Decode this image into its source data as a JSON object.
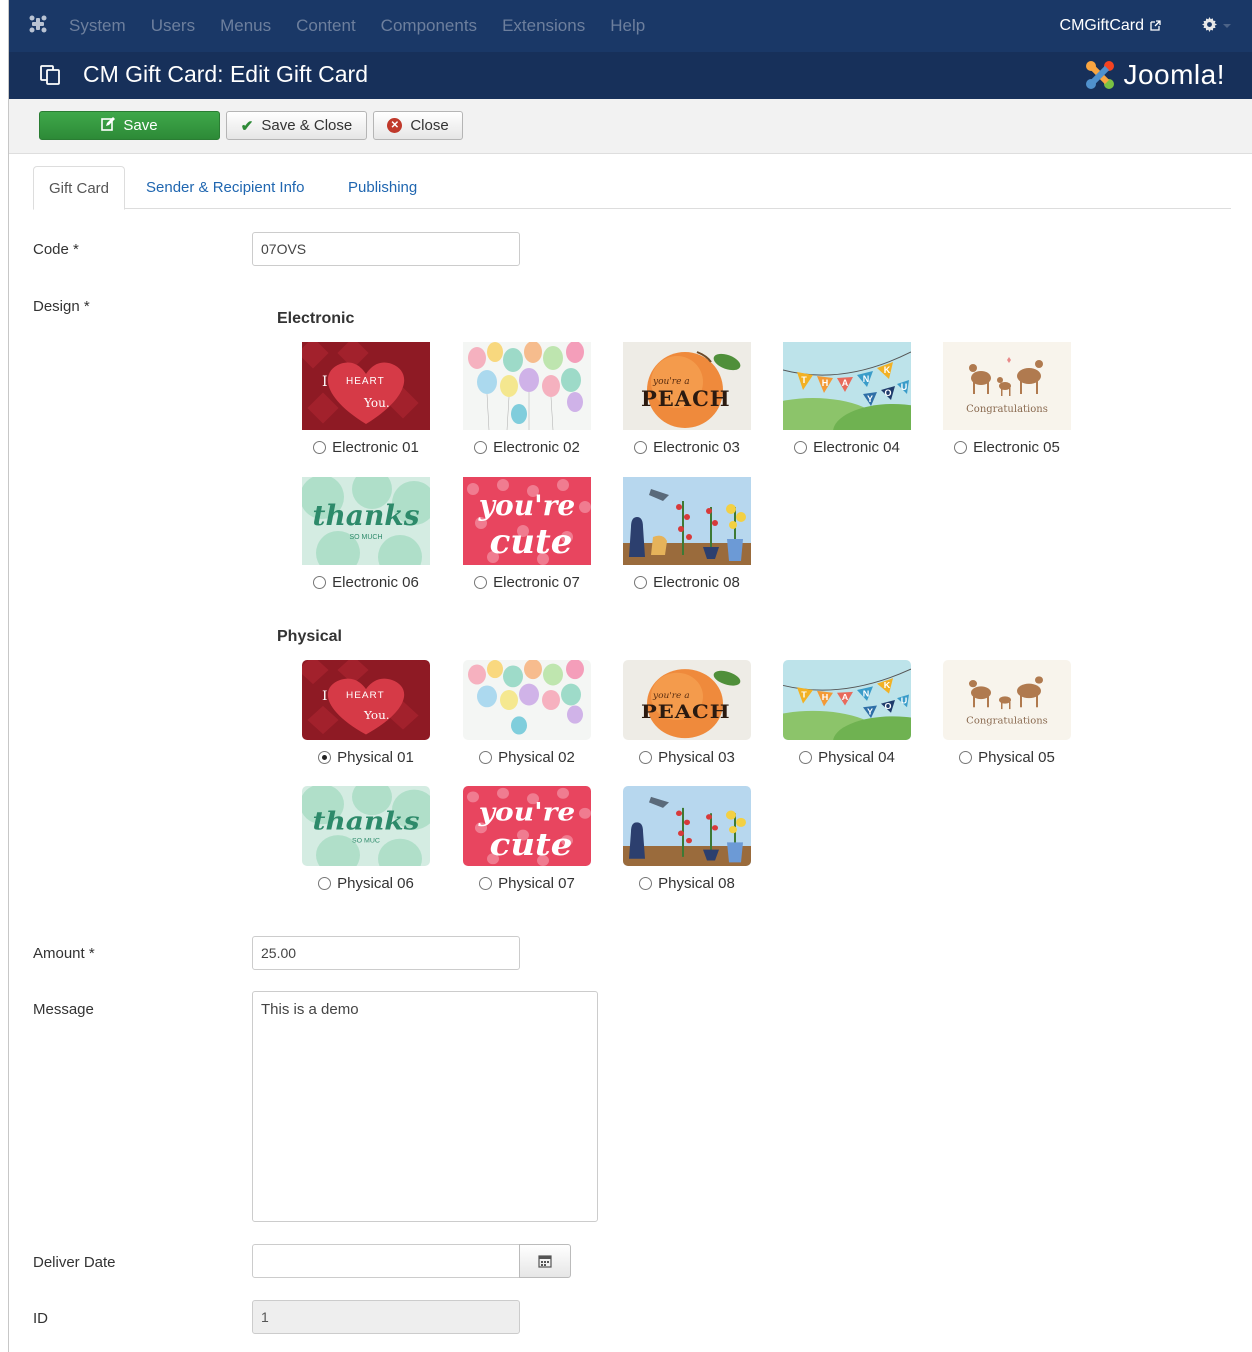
{
  "topnav": {
    "menu": [
      "System",
      "Users",
      "Menus",
      "Content",
      "Components",
      "Extensions",
      "Help"
    ],
    "site_name": "CMGiftCard"
  },
  "titlebar": {
    "title": "CM Gift Card: Edit Gift Card",
    "brand": "Joomla!"
  },
  "toolbar": {
    "save": "Save",
    "save_close": "Save & Close",
    "close": "Close"
  },
  "tabs": [
    "Gift Card",
    "Sender & Recipient Info",
    "Publishing"
  ],
  "form": {
    "code_label": "Code *",
    "code_value": "07OVS",
    "design_label": "Design *",
    "amount_label": "Amount *",
    "amount_value": "25.00",
    "message_label": "Message",
    "message_value": "This is a demo",
    "deliver_label": "Deliver Date",
    "deliver_value": "",
    "id_label": "ID",
    "id_value": "1"
  },
  "design": {
    "electronic_heading": "Electronic",
    "physical_heading": "Physical",
    "electronic": [
      "Electronic 01",
      "Electronic 02",
      "Electronic 03",
      "Electronic 04",
      "Electronic 05",
      "Electronic 06",
      "Electronic 07",
      "Electronic 08"
    ],
    "physical": [
      "Physical 01",
      "Physical 02",
      "Physical 03",
      "Physical 04",
      "Physical 05",
      "Physical 06",
      "Physical 07",
      "Physical 08"
    ],
    "selected": "Physical 01"
  },
  "card_art": {
    "heart_text_1": "I",
    "heart_text_2": "HEART",
    "heart_text_3": "You.",
    "peach_small": "you're a",
    "peach_big": "PEACH",
    "thank_you": [
      "T",
      "H",
      "A",
      "N",
      "K",
      "Y",
      "O",
      "U"
    ],
    "congrats": "Congratulations",
    "thanks_big": "thanks",
    "thanks_small_e": "SO MUCH",
    "thanks_small_p": "SO MUC",
    "cute_1": "you're",
    "cute_2": "cute"
  },
  "colors": {
    "nav_bg": "#1a3867",
    "title_bg": "#17305a",
    "save_green": "#2d8a37",
    "link_blue": "#1f66b0"
  }
}
